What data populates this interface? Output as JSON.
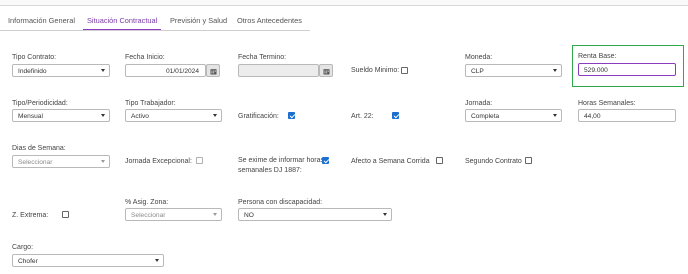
{
  "tabs": [
    {
      "label": "Información General"
    },
    {
      "label": "Situación Contractual"
    },
    {
      "label": "Previsión y Salud"
    },
    {
      "label": "Otros Antecedentes"
    }
  ],
  "form": {
    "tipo_contrato": {
      "label": "Tipo Contrato:",
      "value": "Indefinido"
    },
    "fecha_inicio": {
      "label": "Fecha Inicio:",
      "value": "01/01/2024"
    },
    "fecha_termino": {
      "label": "Fecha Termino:",
      "value": ""
    },
    "sueldo_minimo": {
      "label": "Sueldo Minimo:",
      "checked": false
    },
    "moneda": {
      "label": "Moneda:",
      "value": "CLP"
    },
    "renta_base": {
      "label": "Renta Base:",
      "value": "529.000"
    },
    "tipo_periodicidad": {
      "label": "Tipo/Periodicidad:",
      "value": "Mensual"
    },
    "tipo_trabajador": {
      "label": "Tipo Trabajador:",
      "value": "Activo"
    },
    "gratificacion": {
      "label": "Gratificación:",
      "checked": true
    },
    "art22": {
      "label": "Art. 22:",
      "checked": true
    },
    "jornada": {
      "label": "Jornada:",
      "value": "Completa"
    },
    "horas_semanales": {
      "label": "Horas Semanales:",
      "value": "44,00"
    },
    "dias_semana": {
      "label": "Dias de Semana:",
      "placeholder": "Seleccionar"
    },
    "jornada_excepcional": {
      "label": "Jornada Excepcional:",
      "checked": false
    },
    "exime_informar": {
      "label_line1": "Se exime de informar horas",
      "label_line2": "semanales DJ 1887:",
      "checked": true
    },
    "afecto_semana_corrida": {
      "label": "Afecto a Semana Corrida",
      "checked": false
    },
    "segundo_contrato": {
      "label": "Segundo Contrato",
      "checked": false
    },
    "z_extrema": {
      "label": "Z. Extrema:",
      "checked": false
    },
    "asig_zona": {
      "label": "% Asig. Zona:",
      "placeholder": "Seleccionar"
    },
    "persona_discapacidad": {
      "label": "Persona con discapacidad:",
      "value": "NO"
    },
    "cargo": {
      "label": "Cargo:",
      "value": "Chofer"
    }
  },
  "colors": {
    "accent": "#8a3bc0",
    "checkbox": "#1a6fd0",
    "highlight": "#2fa84a"
  },
  "icons": {
    "calendar": "calendar-icon",
    "caret": "chevron-down-icon"
  }
}
